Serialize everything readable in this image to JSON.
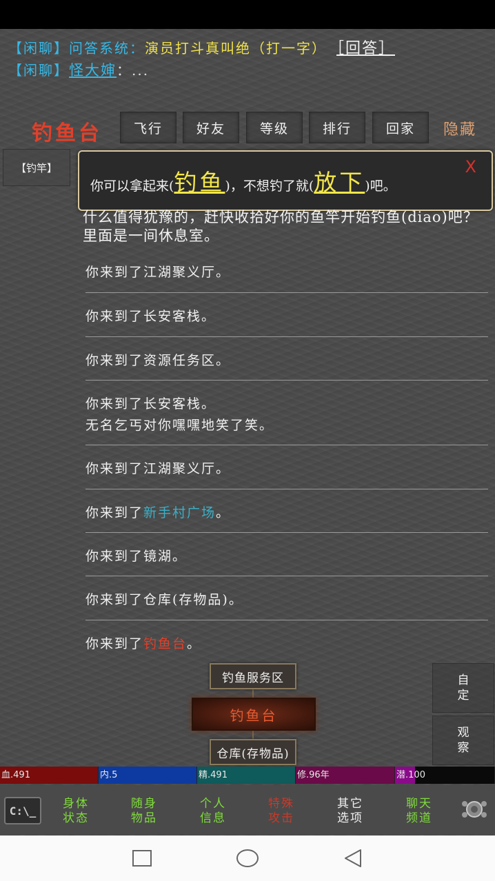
{
  "chat": {
    "line1": {
      "tag": "【闲聊】",
      "system": "问答系统：",
      "question": "演员打斗真叫绝（打一字）",
      "answer": "［回答］"
    },
    "line2": {
      "tag": "【闲聊】",
      "user": "怪大婶",
      "sep": "：",
      "message": "..."
    }
  },
  "location": {
    "title": "钓鱼台"
  },
  "top_menu": [
    "飞行",
    "好友",
    "等级",
    "排行",
    "回家"
  ],
  "hide_label": "隐藏",
  "item_tag": "【钓竿】",
  "popup": {
    "pre": "你可以拿起来(",
    "link1": "钓鱼",
    "mid": ")，不想钓了就(",
    "link2": "放下",
    "post": ")吧。",
    "close": "X"
  },
  "description": "什么值得犹豫的，赶快收拾好你的鱼竿开始钓鱼(diao)吧？里面是一间休息室。",
  "log": [
    {
      "text": "你来到了江湖聚义厅。"
    },
    {
      "text": "你来到了长安客栈。"
    },
    {
      "text": "你来到了资源任务区。"
    },
    {
      "text": "你来到了长安客栈。",
      "line2": "无名乞丐对你嘿嘿地笑了笑。"
    },
    {
      "text": "你来到了江湖聚义厅。"
    },
    {
      "text": "你来到了",
      "place": "新手村广场",
      "end": "。",
      "place_color": "#3ab0c8"
    },
    {
      "text": "你来到了镜湖。"
    },
    {
      "text": "你来到了仓库(存物品)。"
    },
    {
      "text": "你来到了",
      "place": "钓鱼台",
      "end": "。",
      "place_color": "#e0402a"
    }
  ],
  "map": {
    "north": "钓鱼服务区",
    "current": "钓鱼台",
    "south": "仓库(存物品)"
  },
  "side_buttons": [
    {
      "l1": "自",
      "l2": "定"
    },
    {
      "l1": "观",
      "l2": "察"
    }
  ],
  "stats": [
    {
      "label": "血",
      "value": ".491",
      "color": "#7a0c0c",
      "fill": 1.0
    },
    {
      "label": "内",
      "value": ".5",
      "color": "#0d3aa0",
      "fill": 1.0
    },
    {
      "label": "精",
      "value": ".491",
      "color": "#0f5a5a",
      "fill": 1.0
    },
    {
      "label": "修",
      "value": ".96年",
      "color": "#6a0a48",
      "fill": 1.0
    },
    {
      "label": "潜",
      "value": ".100",
      "color": "#8a0a8a",
      "fill": 0.2
    }
  ],
  "bottom_menu": [
    {
      "l1": "身体",
      "l2": "状态",
      "color": "#7fdc3a"
    },
    {
      "l1": "随身",
      "l2": "物品",
      "color": "#7fdc3a"
    },
    {
      "l1": "个人",
      "l2": "信息",
      "color": "#7fdc3a"
    },
    {
      "l1": "特殊",
      "l2": "攻击",
      "color": "#c83a2a"
    },
    {
      "l1": "其它",
      "l2": "选项",
      "color": "#f0f0f0"
    },
    {
      "l1": "聊天",
      "l2": "频道",
      "color": "#7fdc3a"
    }
  ],
  "cmd_label": "C:\\_"
}
